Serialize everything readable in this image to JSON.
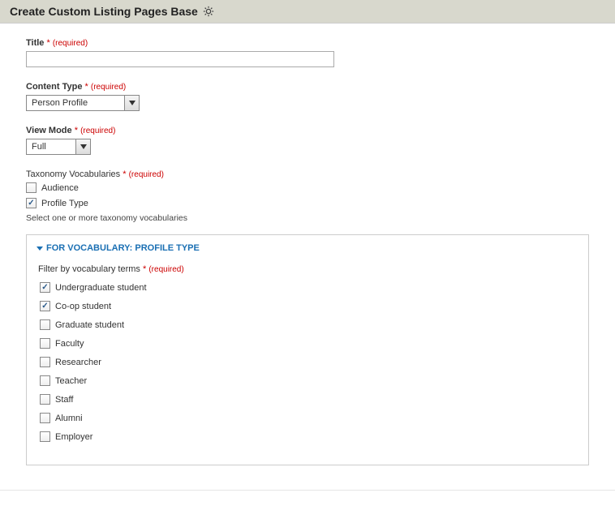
{
  "header": {
    "title": "Create Custom Listing Pages Base"
  },
  "required_mark": "*",
  "required_text": "(required)",
  "fields": {
    "title": {
      "label": "Title",
      "value": ""
    },
    "content_type": {
      "label": "Content Type",
      "value": "Person Profile"
    },
    "view_mode": {
      "label": "View Mode",
      "value": "Full"
    },
    "taxonomy": {
      "label": "Taxonomy Vocabularies",
      "helper": "Select one or more taxonomy vocabularies",
      "options": [
        {
          "label": "Audience",
          "checked": false
        },
        {
          "label": "Profile Type",
          "checked": true
        }
      ]
    }
  },
  "fieldset": {
    "title": "FOR VOCABULARY: PROFILE TYPE",
    "filter_label": "Filter by vocabulary terms",
    "terms": [
      {
        "label": "Undergraduate student",
        "checked": true
      },
      {
        "label": "Co-op student",
        "checked": true
      },
      {
        "label": "Graduate student",
        "checked": false
      },
      {
        "label": "Faculty",
        "checked": false
      },
      {
        "label": "Researcher",
        "checked": false
      },
      {
        "label": "Teacher",
        "checked": false
      },
      {
        "label": "Staff",
        "checked": false
      },
      {
        "label": "Alumni",
        "checked": false
      },
      {
        "label": "Employer",
        "checked": false
      }
    ]
  }
}
